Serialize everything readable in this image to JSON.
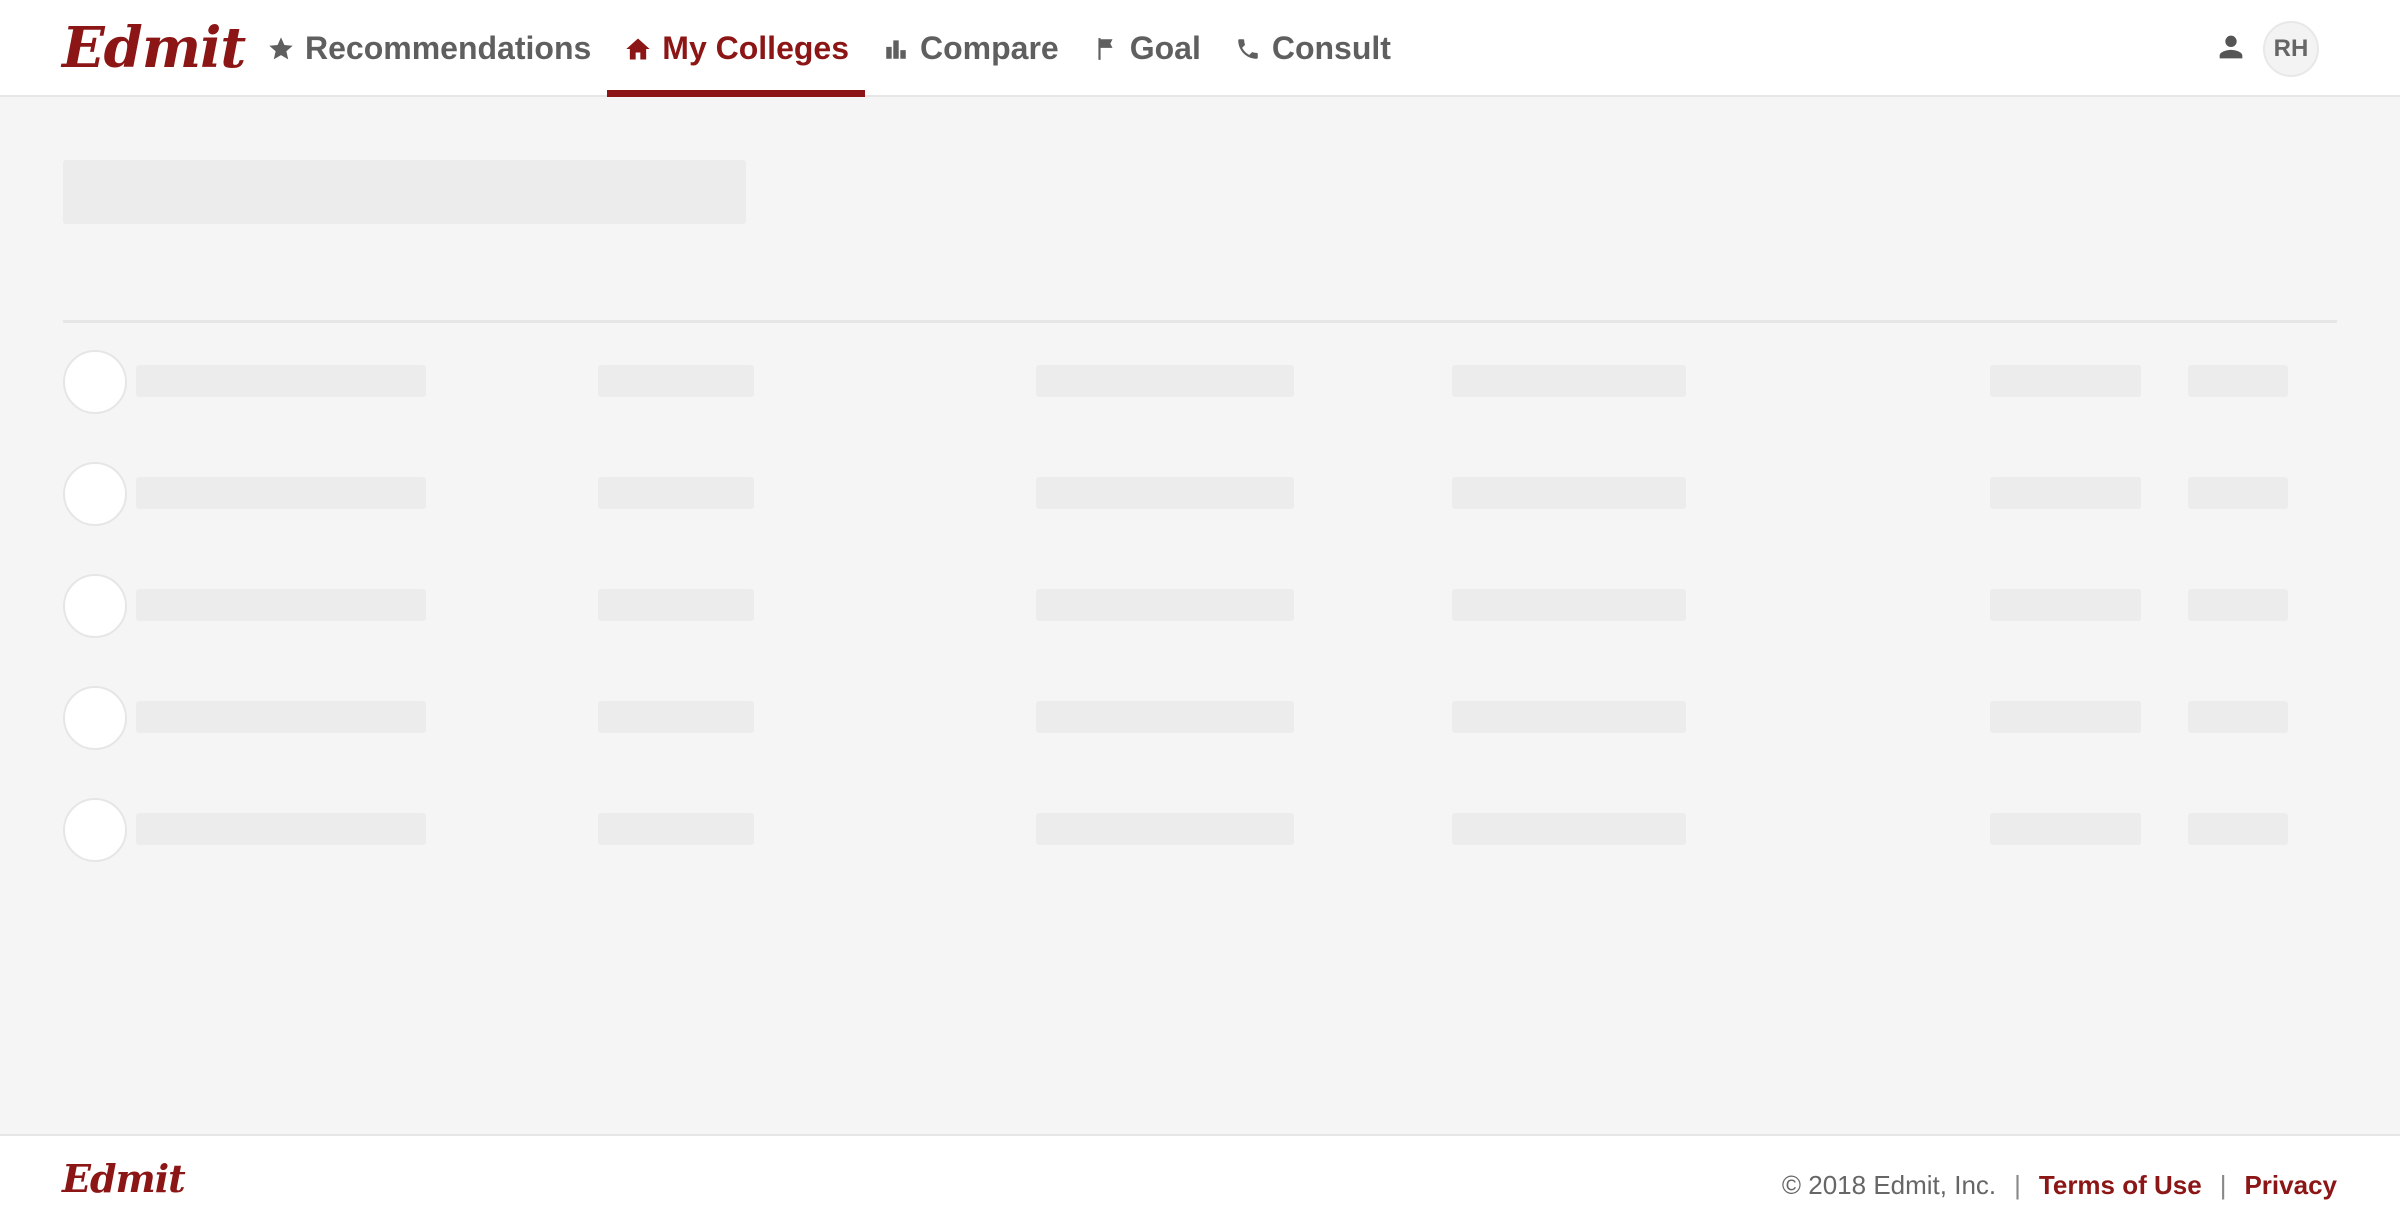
{
  "brand": {
    "name": "Edmit",
    "accent": "#8c1515"
  },
  "nav": {
    "items": [
      {
        "label": "Recommendations",
        "icon": "star-icon"
      },
      {
        "label": "My Colleges",
        "icon": "home-icon",
        "active": true
      },
      {
        "label": "Compare",
        "icon": "bar-chart-icon"
      },
      {
        "label": "Goal",
        "icon": "flag-icon"
      },
      {
        "label": "Consult",
        "icon": "phone-icon"
      }
    ]
  },
  "user": {
    "initials": "RH",
    "icon": "user-icon"
  },
  "main": {
    "loading": true,
    "skeleton_row_count": 5
  },
  "footer": {
    "logo": "Edmit",
    "copyright": "© 2018 Edmit, Inc.",
    "separator": "|",
    "links": [
      "Terms of Use",
      "Privacy"
    ]
  }
}
